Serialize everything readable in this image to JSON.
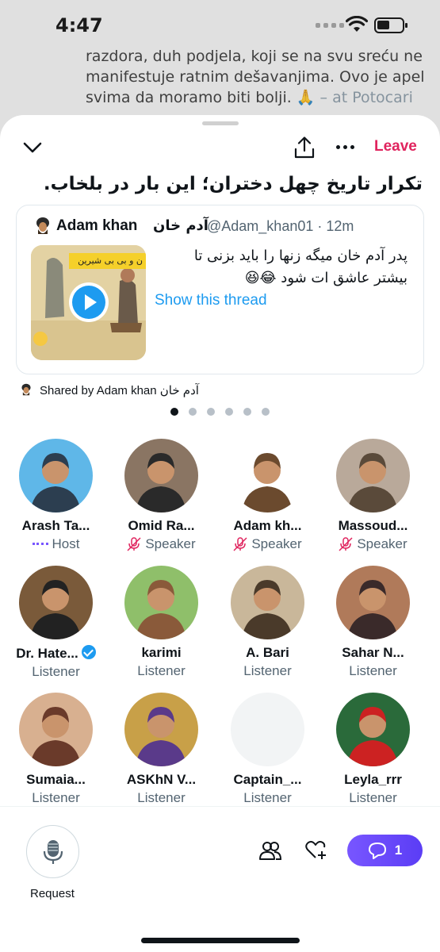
{
  "status_bar": {
    "time": "4:47"
  },
  "background_tweet": {
    "text": "razdora, duh podjela, koji se na svu sreću ne manifestuje ratnim dešavanjima. Ovo je apel svima da moramo biti bolji. 🙏",
    "location": " – at Potocari"
  },
  "header": {
    "leave_label": "Leave",
    "icons": [
      "chevron-down-icon",
      "share-icon",
      "more-icon"
    ]
  },
  "space": {
    "title": "تکرار تاریخ چهل دختران؛ این بار در بلخاب."
  },
  "pinned_tweet": {
    "author_name": "Adam khan",
    "author_name_fa": "آدم خان",
    "handle_time": "@Adam_khan01 · 12m",
    "text": "پدر آدم خان میگه زنها را باید بزنی تا بیشتر عاشق ات شود 😂😆",
    "media_banner": "ن و بی بی شیرین",
    "show_thread": "Show this thread"
  },
  "shared_by": "Shared by Adam khan آدم خان",
  "pagination": {
    "total": 6,
    "active": 1
  },
  "participants": [
    {
      "name": "Arash Ta...",
      "role": "Host",
      "role_icon": "host-icon",
      "colors": [
        "#5fb7e8",
        "#2c3e50"
      ]
    },
    {
      "name": "Omid Ra...",
      "role": "Speaker",
      "role_icon": "mic-off-icon",
      "colors": [
        "#8a7563",
        "#2a2a2a"
      ]
    },
    {
      "name": "Adam kh...",
      "role": "Speaker",
      "role_icon": "mic-off-icon",
      "colors": [
        "#ffffff",
        "#6b4a2e"
      ]
    },
    {
      "name": "Massoud...",
      "role": "Speaker",
      "role_icon": "mic-off-icon",
      "colors": [
        "#b9a99a",
        "#5a4a3a"
      ]
    },
    {
      "name": "Dr. Hate...",
      "role": "Listener",
      "verified": true,
      "colors": [
        "#7a5a3a",
        "#222222"
      ]
    },
    {
      "name": "karimi",
      "role": "Listener",
      "colors": [
        "#8fbf6a",
        "#8a5a3a"
      ]
    },
    {
      "name": "A. Bari",
      "role": "Listener",
      "colors": [
        "#c9b79a",
        "#4a3a2a"
      ]
    },
    {
      "name": "Sahar N...",
      "role": "Listener",
      "colors": [
        "#b07a5a",
        "#3a2a2a"
      ]
    },
    {
      "name": "Sumaia...",
      "role": "Listener",
      "colors": [
        "#d8b090",
        "#6a3a2a"
      ]
    },
    {
      "name": "ASKhN V...",
      "role": "Listener",
      "colors": [
        "#c8a048",
        "#5a3a8a"
      ]
    },
    {
      "name": "Captain_...",
      "role": "Listener",
      "colors": [
        "#f2f4f5",
        "#f2f4f5"
      ]
    },
    {
      "name": "Leyla_rrr",
      "role": "Listener",
      "colors": [
        "#2a6a3a",
        "#cc2222"
      ]
    }
  ],
  "bottom_bar": {
    "request_label": "Request",
    "comments_count": "1"
  },
  "colors": {
    "accent": "#7856ff",
    "leave": "#e0245e",
    "link": "#1d9bf0"
  }
}
